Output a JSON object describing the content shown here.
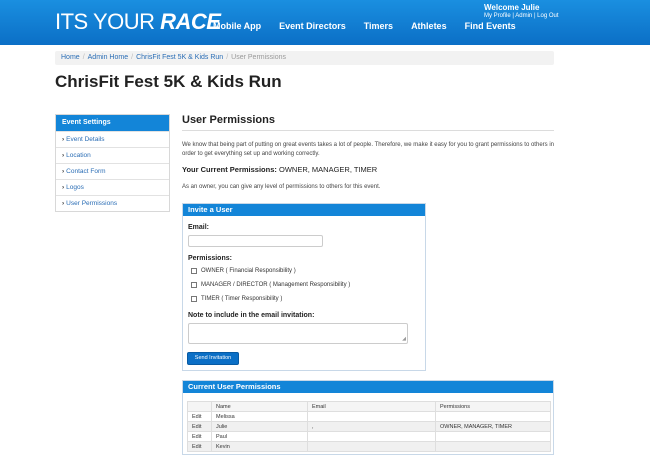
{
  "header": {
    "logo_prefix": "ITS YOUR",
    "logo_suffix": "RACE",
    "nav": [
      "Mobile App",
      "Event Directors",
      "Timers",
      "Athletes",
      "Find Events"
    ],
    "welcome": "Welcome Julie",
    "user_links": [
      "My Profile",
      "Admin",
      "Log Out"
    ],
    "accent": "#0b6fc6"
  },
  "breadcrumb": {
    "items": [
      "Home",
      "Admin Home",
      "ChrisFit Fest 5K & Kids Run"
    ],
    "current": "User Permissions"
  },
  "page_title": "ChrisFit Fest 5K & Kids Run",
  "sidebar": {
    "heading": "Event Settings",
    "items": [
      "Event Details",
      "Location",
      "Contact Form",
      "Logos",
      "User Permissions"
    ]
  },
  "main": {
    "title": "User Permissions",
    "intro": "We know that being part of putting on great events takes a lot of people. Therefore, we make it easy for you to grant permissions to others in order to get everything set up and working correctly.",
    "current_label": "Your Current Permissions:",
    "current_value": "OWNER, MANAGER, TIMER",
    "owner_note": "As an owner, you can give any level of permissions to others for this event."
  },
  "invite": {
    "heading": "Invite a User",
    "email_label": "Email:",
    "email_value": "",
    "permissions_label": "Permissions:",
    "permissions": [
      "OWNER ( Financial Responsibility )",
      "MANAGER / DIRECTOR ( Management Responsibility )",
      "TIMER ( Timer Responsibility )"
    ],
    "note_label": "Note to include in the email invitation:",
    "send_label": "Send Invitation"
  },
  "current_permissions": {
    "heading": "Current User Permissions",
    "columns": [
      "",
      "Name",
      "Email",
      "Permissions"
    ],
    "rows": [
      {
        "action": "Edit",
        "name": "Melissa",
        "email": "",
        "permissions": ""
      },
      {
        "action": "Edit",
        "name": "Julie",
        "email": ",",
        "permissions": "OWNER, MANAGER, TIMER"
      },
      {
        "action": "Edit",
        "name": "Paul",
        "email": "",
        "permissions": ""
      },
      {
        "action": "Edit",
        "name": "Kevin",
        "email": "",
        "permissions": ""
      }
    ]
  }
}
